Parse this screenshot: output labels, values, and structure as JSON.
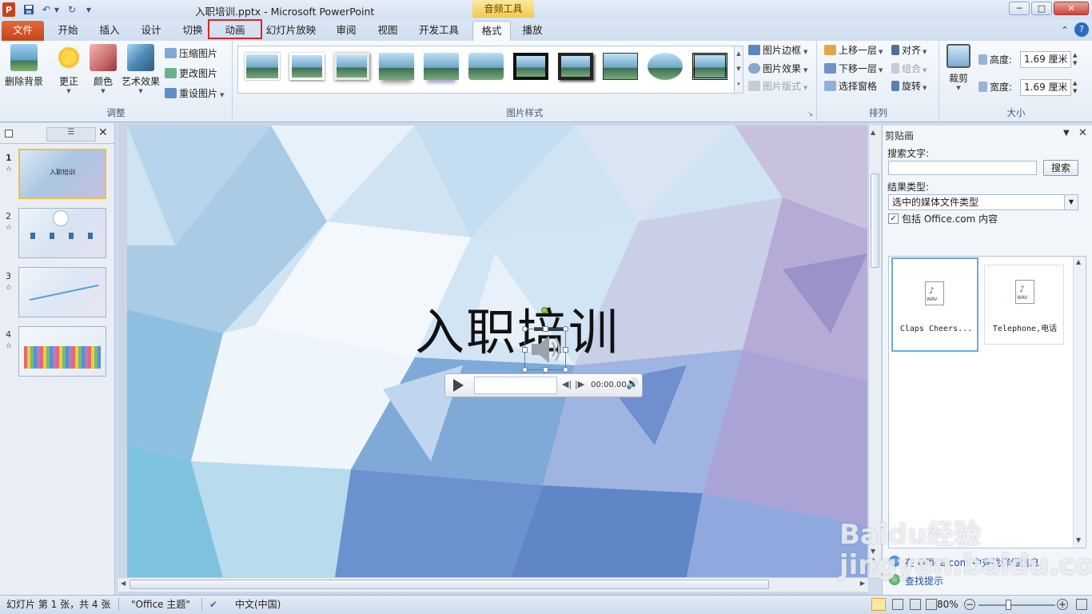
{
  "window": {
    "title": "入职培训.pptx - Microsoft PowerPoint",
    "context_group": "音频工具",
    "minimize": "─",
    "maximize": "□",
    "close": "✕"
  },
  "tabs": [
    {
      "label": "文件"
    },
    {
      "label": "开始"
    },
    {
      "label": "插入"
    },
    {
      "label": "设计"
    },
    {
      "label": "切换"
    },
    {
      "label": "动画"
    },
    {
      "label": "幻灯片放映"
    },
    {
      "label": "审阅"
    },
    {
      "label": "视图"
    },
    {
      "label": "开发工具"
    },
    {
      "label": "格式"
    },
    {
      "label": "播放"
    }
  ],
  "ribbon": {
    "adjust": {
      "remove_bg": "删除背景",
      "correct": "更正",
      "color": "颜色",
      "art_effects": "艺术效果",
      "compress": "压缩图片",
      "change": "更改图片",
      "reset": "重设图片",
      "group_label": "调整"
    },
    "styles": {
      "group_label": "图片样式",
      "border": "图片边框",
      "effects": "图片效果",
      "layout": "图片版式"
    },
    "arrange": {
      "forward": "上移一层",
      "backward": "下移一层",
      "selection_pane": "选择窗格",
      "align": "对齐",
      "group": "组合",
      "rotate": "旋转",
      "group_label": "排列"
    },
    "size": {
      "crop": "裁剪",
      "height_label": "高度:",
      "height_value": "1.69 厘米",
      "width_label": "宽度:",
      "width_value": "1.69 厘米",
      "group_label": "大小"
    }
  },
  "slides": [
    {
      "num": "1",
      "title": "入职培训"
    },
    {
      "num": "2"
    },
    {
      "num": "3"
    },
    {
      "num": "4"
    }
  ],
  "slide": {
    "title": "入职培训",
    "player_time": "00:00.00"
  },
  "clipart": {
    "title": "剪贴画",
    "search_label": "搜索文字:",
    "search_value": "",
    "search_button": "搜索",
    "result_type_label": "结果类型:",
    "result_type_value": "选中的媒体文件类型",
    "include_office": "包括 Office.com 内容",
    "include_checked": true,
    "results": [
      {
        "label": "Claps Cheers...",
        "badge": "WAV"
      },
      {
        "label": "Telephone,电话",
        "badge": "WAV"
      }
    ],
    "link_office": "在 Office.com 中查找详细信息",
    "link_tips": "查找提示"
  },
  "status": {
    "slide_info": "幻灯片 第 1 张，共 4 张",
    "theme": "\"Office 主题\"",
    "language": "中文(中国)",
    "zoom": "80%"
  },
  "watermark": "Baidu经验\njingyan.baidu.com",
  "colors": {
    "file_tab": "#c7431c",
    "context_group": "#f2c94c",
    "highlight_box": "#e02424",
    "selection_border": "#6fa8dc"
  }
}
